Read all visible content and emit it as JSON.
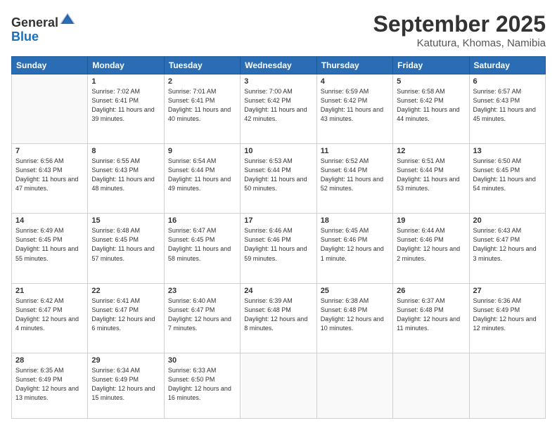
{
  "logo": {
    "general": "General",
    "blue": "Blue"
  },
  "header": {
    "month": "September 2025",
    "location": "Katutura, Khomas, Namibia"
  },
  "weekdays": [
    "Sunday",
    "Monday",
    "Tuesday",
    "Wednesday",
    "Thursday",
    "Friday",
    "Saturday"
  ],
  "weeks": [
    [
      {
        "day": "",
        "empty": true
      },
      {
        "day": "1",
        "sunrise": "7:02 AM",
        "sunset": "6:41 PM",
        "daylight": "11 hours and 39 minutes."
      },
      {
        "day": "2",
        "sunrise": "7:01 AM",
        "sunset": "6:41 PM",
        "daylight": "11 hours and 40 minutes."
      },
      {
        "day": "3",
        "sunrise": "7:00 AM",
        "sunset": "6:42 PM",
        "daylight": "11 hours and 42 minutes."
      },
      {
        "day": "4",
        "sunrise": "6:59 AM",
        "sunset": "6:42 PM",
        "daylight": "11 hours and 43 minutes."
      },
      {
        "day": "5",
        "sunrise": "6:58 AM",
        "sunset": "6:42 PM",
        "daylight": "11 hours and 44 minutes."
      },
      {
        "day": "6",
        "sunrise": "6:57 AM",
        "sunset": "6:43 PM",
        "daylight": "11 hours and 45 minutes."
      }
    ],
    [
      {
        "day": "7",
        "sunrise": "6:56 AM",
        "sunset": "6:43 PM",
        "daylight": "11 hours and 47 minutes."
      },
      {
        "day": "8",
        "sunrise": "6:55 AM",
        "sunset": "6:43 PM",
        "daylight": "11 hours and 48 minutes."
      },
      {
        "day": "9",
        "sunrise": "6:54 AM",
        "sunset": "6:44 PM",
        "daylight": "11 hours and 49 minutes."
      },
      {
        "day": "10",
        "sunrise": "6:53 AM",
        "sunset": "6:44 PM",
        "daylight": "11 hours and 50 minutes."
      },
      {
        "day": "11",
        "sunrise": "6:52 AM",
        "sunset": "6:44 PM",
        "daylight": "11 hours and 52 minutes."
      },
      {
        "day": "12",
        "sunrise": "6:51 AM",
        "sunset": "6:44 PM",
        "daylight": "11 hours and 53 minutes."
      },
      {
        "day": "13",
        "sunrise": "6:50 AM",
        "sunset": "6:45 PM",
        "daylight": "11 hours and 54 minutes."
      }
    ],
    [
      {
        "day": "14",
        "sunrise": "6:49 AM",
        "sunset": "6:45 PM",
        "daylight": "11 hours and 55 minutes."
      },
      {
        "day": "15",
        "sunrise": "6:48 AM",
        "sunset": "6:45 PM",
        "daylight": "11 hours and 57 minutes."
      },
      {
        "day": "16",
        "sunrise": "6:47 AM",
        "sunset": "6:45 PM",
        "daylight": "11 hours and 58 minutes."
      },
      {
        "day": "17",
        "sunrise": "6:46 AM",
        "sunset": "6:46 PM",
        "daylight": "11 hours and 59 minutes."
      },
      {
        "day": "18",
        "sunrise": "6:45 AM",
        "sunset": "6:46 PM",
        "daylight": "12 hours and 1 minute."
      },
      {
        "day": "19",
        "sunrise": "6:44 AM",
        "sunset": "6:46 PM",
        "daylight": "12 hours and 2 minutes."
      },
      {
        "day": "20",
        "sunrise": "6:43 AM",
        "sunset": "6:47 PM",
        "daylight": "12 hours and 3 minutes."
      }
    ],
    [
      {
        "day": "21",
        "sunrise": "6:42 AM",
        "sunset": "6:47 PM",
        "daylight": "12 hours and 4 minutes."
      },
      {
        "day": "22",
        "sunrise": "6:41 AM",
        "sunset": "6:47 PM",
        "daylight": "12 hours and 6 minutes."
      },
      {
        "day": "23",
        "sunrise": "6:40 AM",
        "sunset": "6:47 PM",
        "daylight": "12 hours and 7 minutes."
      },
      {
        "day": "24",
        "sunrise": "6:39 AM",
        "sunset": "6:48 PM",
        "daylight": "12 hours and 8 minutes."
      },
      {
        "day": "25",
        "sunrise": "6:38 AM",
        "sunset": "6:48 PM",
        "daylight": "12 hours and 10 minutes."
      },
      {
        "day": "26",
        "sunrise": "6:37 AM",
        "sunset": "6:48 PM",
        "daylight": "12 hours and 11 minutes."
      },
      {
        "day": "27",
        "sunrise": "6:36 AM",
        "sunset": "6:49 PM",
        "daylight": "12 hours and 12 minutes."
      }
    ],
    [
      {
        "day": "28",
        "sunrise": "6:35 AM",
        "sunset": "6:49 PM",
        "daylight": "12 hours and 13 minutes."
      },
      {
        "day": "29",
        "sunrise": "6:34 AM",
        "sunset": "6:49 PM",
        "daylight": "12 hours and 15 minutes."
      },
      {
        "day": "30",
        "sunrise": "6:33 AM",
        "sunset": "6:50 PM",
        "daylight": "12 hours and 16 minutes."
      },
      {
        "day": "",
        "empty": true
      },
      {
        "day": "",
        "empty": true
      },
      {
        "day": "",
        "empty": true
      },
      {
        "day": "",
        "empty": true
      }
    ]
  ]
}
